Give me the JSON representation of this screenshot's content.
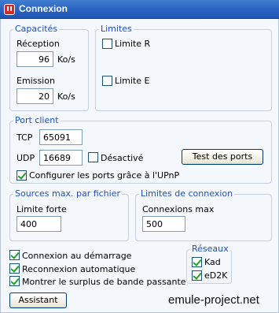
{
  "window": {
    "title": "Connexion"
  },
  "capacities": {
    "legend": "Capacités",
    "reception_label": "Réception",
    "reception_value": "96",
    "reception_unit": "Ko/s",
    "emission_label": "Emission",
    "emission_value": "20",
    "emission_unit": "Ko/s"
  },
  "limits": {
    "legend": "Limites",
    "limit_r_label": "Limite R",
    "limit_r_checked": false,
    "limit_e_label": "Limite E",
    "limit_e_checked": false
  },
  "port_client": {
    "legend": "Port client",
    "tcp_label": "TCP",
    "tcp_value": "65091",
    "udp_label": "UDP",
    "udp_value": "16689",
    "disabled_label": "Désactivé",
    "disabled_checked": false,
    "test_button": "Test des ports",
    "upnp_label": "Configurer les ports grâce à l'UPnP",
    "upnp_checked": true
  },
  "sources": {
    "legend": "Sources max. par fichier",
    "hard_limit_label": "Limite forte",
    "hard_limit_value": "400"
  },
  "connection_limits": {
    "legend": "Limites de connexion",
    "max_connections_label": "Connexions max",
    "max_connections_value": "500"
  },
  "options": {
    "autoconnect_label": "Connexion au démarrage",
    "autoconnect_checked": true,
    "reconnect_label": "Reconnexion automatique",
    "reconnect_checked": true,
    "overhead_label": "Montrer le surplus de bande passante",
    "overhead_checked": true
  },
  "networks": {
    "legend": "Réseaux",
    "kad_label": "Kad",
    "kad_checked": true,
    "ed2k_label": "eD2K",
    "ed2k_checked": true
  },
  "wizard_button": "Assistant",
  "watermark": "emule-project.net"
}
